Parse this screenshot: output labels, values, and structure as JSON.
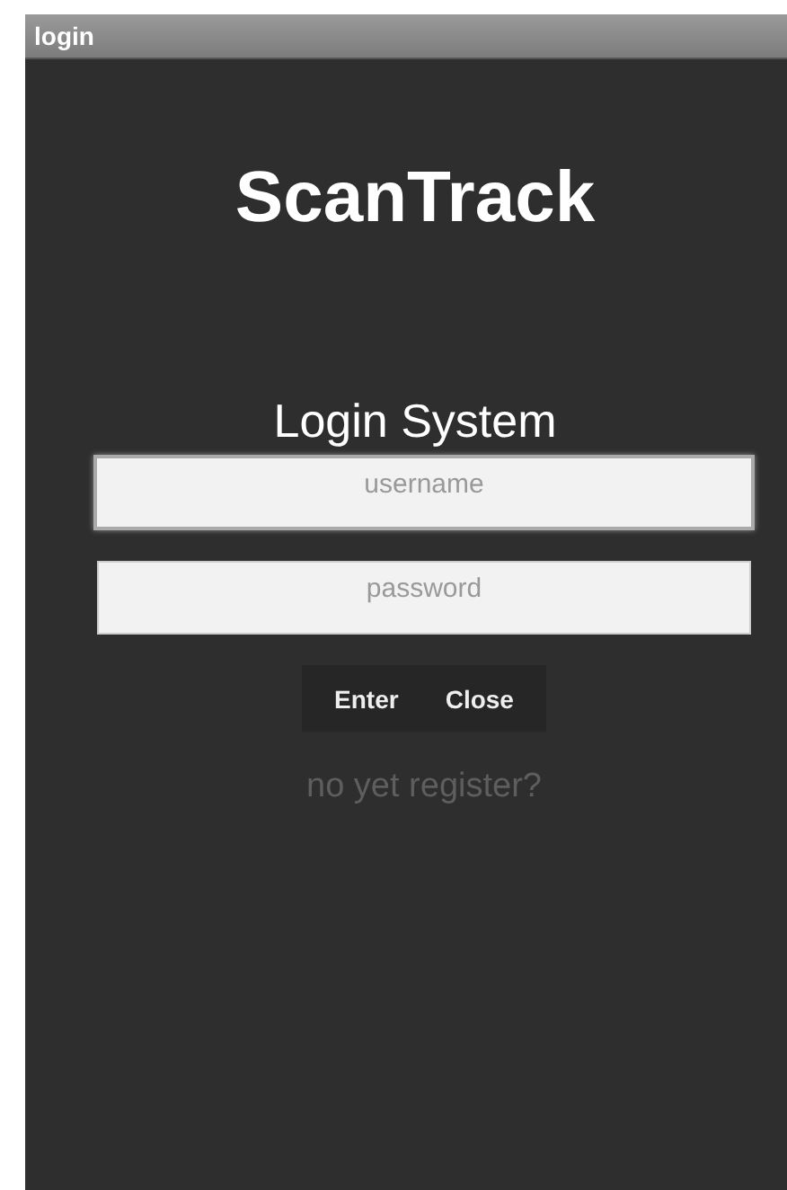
{
  "window": {
    "title": "login"
  },
  "app_title": "ScanTrack",
  "heading": "Login System",
  "fields": [
    {
      "placeholder": "username",
      "focused": true
    },
    {
      "placeholder": "password",
      "focused": false
    }
  ],
  "buttons": [
    "Enter",
    "Close"
  ],
  "register_link": "no yet register?"
}
